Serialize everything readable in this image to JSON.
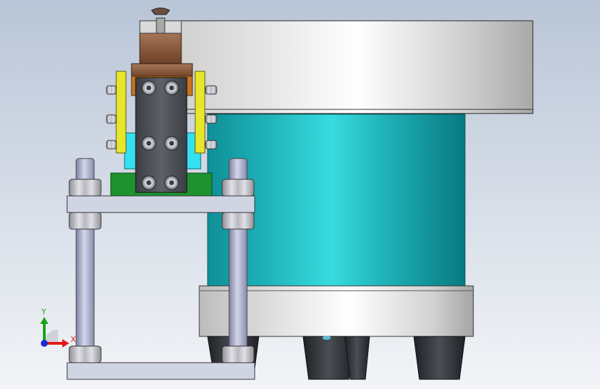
{
  "viewport": {
    "background_top": "#b6c3d6",
    "background_bottom": "#f3f5f8"
  },
  "model": {
    "components": [
      "top-plate",
      "drum-body",
      "bottom-flange",
      "feet",
      "clamp-block",
      "side-plates",
      "guide-rods",
      "hex-nuts",
      "support-plates"
    ],
    "colors": {
      "drum_teal": "#24b7bd",
      "plate_grey": "#d8d8d8",
      "clamp_dark": "#4a4d52",
      "side_yellow": "#e3e31e",
      "block_green": "#1d8f2b",
      "bronze": "#8a5a3a",
      "rod_blue": "#a7abc9",
      "feet_dark": "#2f3236"
    }
  },
  "triad": {
    "x_label": "X",
    "y_label": "Y",
    "x_color": "#e01919",
    "y_color": "#1aa11a",
    "z_color": "#1a2bd6"
  }
}
